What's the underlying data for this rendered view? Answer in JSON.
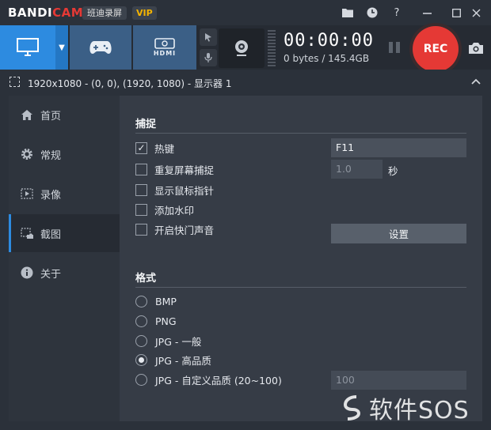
{
  "app": {
    "logo_main": "BANDI",
    "logo_accent": "CAM",
    "edition": "班迪录屏",
    "vip": "VIP"
  },
  "titlebar_icons": [
    "folder-icon",
    "clock-icon",
    "help-icon",
    "minimize-icon",
    "close-icon"
  ],
  "toolbar": {
    "modes": [
      "monitor-icon",
      "gamepad-icon",
      "hdmi-icon"
    ],
    "hdmi_label": "HDMI",
    "timer": "00:00:00",
    "storage": "0 bytes / 145.4GB",
    "rec_label": "REC"
  },
  "region": {
    "text": "1920x1080 - (0, 0), (1920, 1080) - 显示器 1"
  },
  "sidebar": {
    "items": [
      {
        "label": "首页",
        "icon": "home-icon"
      },
      {
        "label": "常规",
        "icon": "gear-icon"
      },
      {
        "label": "录像",
        "icon": "video-icon"
      },
      {
        "label": "截图",
        "icon": "screenshot-icon"
      },
      {
        "label": "关于",
        "icon": "info-icon"
      }
    ],
    "active_index": 3
  },
  "capture": {
    "title": "捕捉",
    "options": [
      {
        "label": "热键",
        "checked": true
      },
      {
        "label": "重复屏幕捕捉",
        "checked": false
      },
      {
        "label": "显示鼠标指针",
        "checked": false
      },
      {
        "label": "添加水印",
        "checked": false
      },
      {
        "label": "开启快门声音",
        "checked": false
      }
    ],
    "hotkey_value": "F11",
    "repeat_value": "1.0",
    "repeat_unit": "秒",
    "settings_button": "设置"
  },
  "format": {
    "title": "格式",
    "options": [
      {
        "label": "BMP",
        "selected": false
      },
      {
        "label": "PNG",
        "selected": false
      },
      {
        "label": "JPG - 一般",
        "selected": false
      },
      {
        "label": "JPG - 高品质",
        "selected": true
      },
      {
        "label": "JPG - 自定义品质 (20~100)",
        "selected": false
      }
    ],
    "custom_quality_value": "100"
  },
  "watermark": {
    "text": "软件SOS"
  },
  "colors": {
    "accent_blue": "#2d8be0",
    "rec_red": "#e53935",
    "vip_gold": "#f5b400"
  }
}
